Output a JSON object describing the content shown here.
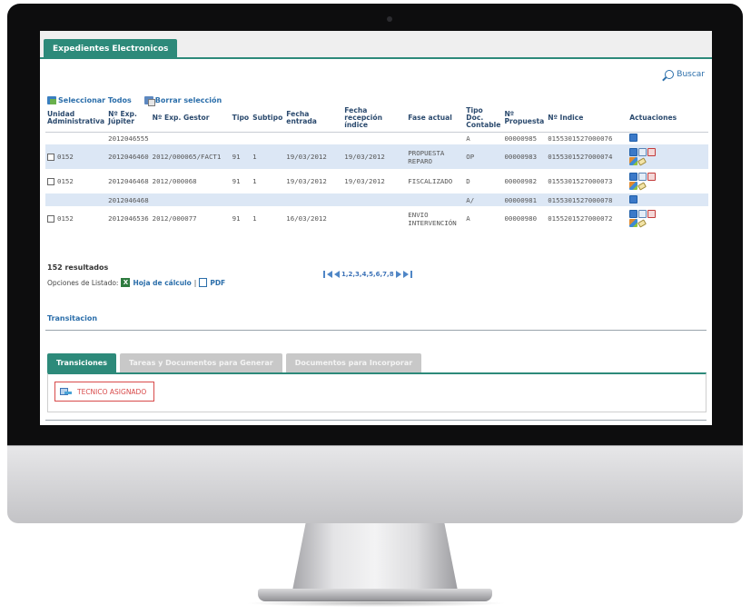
{
  "app": {
    "main_tab": "Expedientes Electronicos"
  },
  "search": {
    "label": "Buscar"
  },
  "selection": {
    "select_all": "Seleccionar Todos",
    "clear": "Borrar selección"
  },
  "table": {
    "headers": [
      "Unidad Administrativa",
      "Nº Exp. Júpiter",
      "Nº Exp. Gestor",
      "Tipo",
      "Subtipo",
      "Fecha entrada",
      "Fecha recepción índice",
      "Fase actual",
      "Tipo Doc. Contable",
      "Nº Propuesta",
      "Nº Indice",
      "Actuaciones"
    ],
    "rows": [
      {
        "unidad": "",
        "jupiter": "2012046555",
        "gestor": "",
        "tipo": "",
        "subtipo": "",
        "fecha_entrada": "",
        "fecha_indice": "",
        "fase": "",
        "tipo_doc": "A",
        "propuesta": "00000985",
        "indice": "0155301527000076"
      },
      {
        "unidad": "0152",
        "jupiter": "2012046460",
        "gestor": "2012/000065/FACT1",
        "tipo": "91",
        "subtipo": "1",
        "fecha_entrada": "19/03/2012",
        "fecha_indice": "19/03/2012",
        "fase": "PROPUESTA REPARO",
        "tipo_doc": "OP",
        "propuesta": "00000983",
        "indice": "0155301527000074"
      },
      {
        "unidad": "0152",
        "jupiter": "2012046468",
        "gestor": "2012/000068",
        "tipo": "91",
        "subtipo": "1",
        "fecha_entrada": "19/03/2012",
        "fecha_indice": "19/03/2012",
        "fase": "FISCALIZADO",
        "tipo_doc": "D",
        "propuesta": "00000982",
        "indice": "0155301527000073"
      },
      {
        "unidad": "",
        "jupiter": "2012046468",
        "gestor": "",
        "tipo": "",
        "subtipo": "",
        "fecha_entrada": "",
        "fecha_indice": "",
        "fase": "",
        "tipo_doc": "A/",
        "propuesta": "00000981",
        "indice": "0155301527000078"
      },
      {
        "unidad": "0152",
        "jupiter": "2012046536",
        "gestor": "2012/000077",
        "tipo": "91",
        "subtipo": "1",
        "fecha_entrada": "16/03/2012",
        "fecha_indice": "",
        "fase": "ENVIO INTERVENCIÓN",
        "tipo_doc": "A",
        "propuesta": "00000980",
        "indice": "0155201527000072"
      }
    ]
  },
  "results_label": "152 resultados",
  "pager": {
    "pages": "1,2,3,4,5,6,7,8"
  },
  "export": {
    "label": "Opciones de Listado:",
    "excel": "Hoja de cálculo",
    "sep": "|",
    "pdf": "PDF"
  },
  "transitions": {
    "title": "Transitacion",
    "tabs": [
      "Transiciones",
      "Tareas y Documentos para Generar",
      "Documentos para Incorporar"
    ],
    "button": "TECNICO ASIGNADO"
  }
}
